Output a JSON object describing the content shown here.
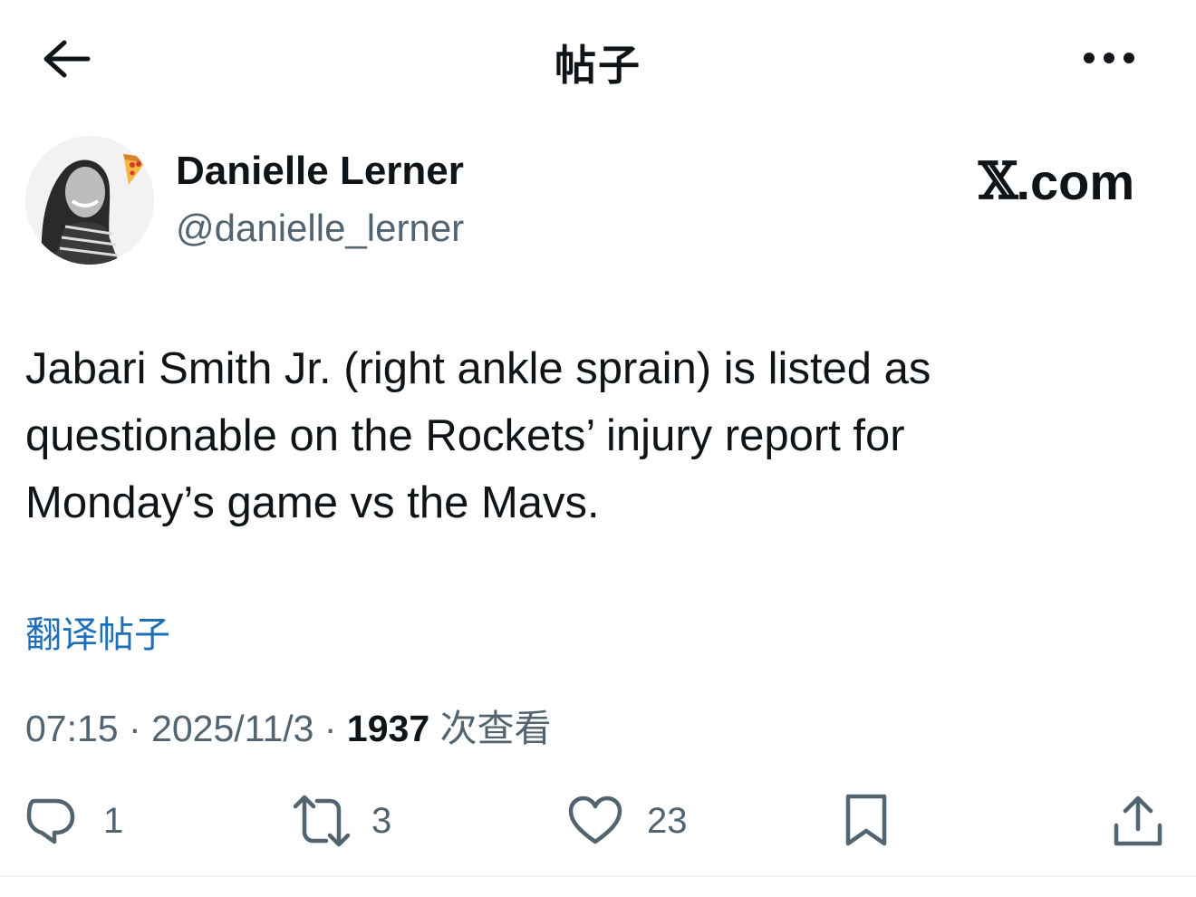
{
  "header": {
    "title": "帖子",
    "back_icon": "arrow-left-icon",
    "more_icon": "more-horizontal-icon"
  },
  "author": {
    "name": "Danielle Lerner",
    "handle": "@danielle_lerner"
  },
  "brand": {
    "x": "𝕏",
    "domain": ".com"
  },
  "tweet": {
    "text": "Jabari Smith Jr. (right ankle sprain) is listed as questionable on the Rockets’ injury report for Monday’s game vs the Mavs."
  },
  "translate_label": "翻译帖子",
  "meta": {
    "time": "07:15",
    "separator": "·",
    "date": "2025/11/3",
    "view_count": "1937",
    "views_label": "次查看"
  },
  "actions": {
    "replies": "1",
    "reposts": "3",
    "likes": "23"
  },
  "colors": {
    "text": "#0f1419",
    "secondary": "#536471",
    "link": "#1d6fb8"
  }
}
